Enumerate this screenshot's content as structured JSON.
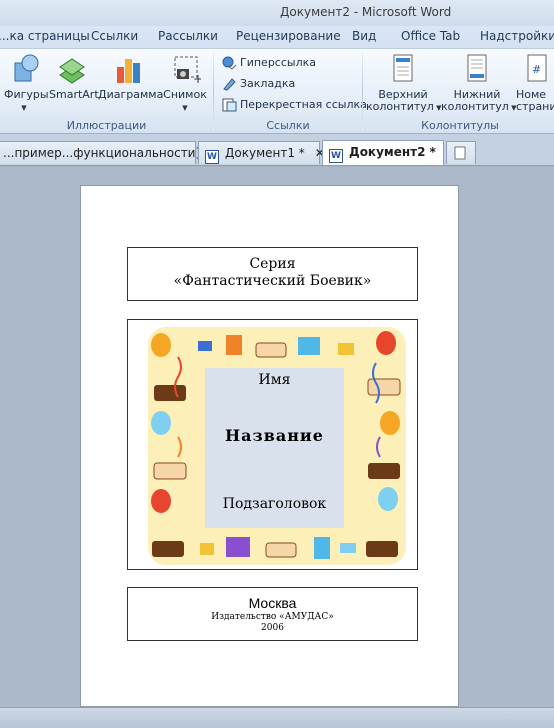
{
  "window": {
    "title": "Документ2  -  Microsoft Word"
  },
  "ribbon_tabs": [
    "...ка страницы",
    "Ссылки",
    "Рассылки",
    "Рецензирование",
    "Вид",
    "Office Tab",
    "Надстройки"
  ],
  "ribbon": {
    "illustrations": {
      "label": "Иллюстрации",
      "buttons": [
        "Фигуры",
        "SmartArt",
        "Диаграмма",
        "Снимок"
      ]
    },
    "links": {
      "label": "Ссылки",
      "buttons": [
        "Гиперссылка",
        "Закладка",
        "Перекрестная ссылка"
      ]
    },
    "headers": {
      "label": "Колонтитулы",
      "header_line1": "Верхний",
      "header_line2": "колонтитул",
      "footer_line1": "Нижний",
      "footer_line2": "колонтитул",
      "pagenum_line1": "Номе",
      "pagenum_line2": "страни"
    }
  },
  "doc_tabs": {
    "tab1": "...пример...функциональности] *",
    "tab2": "Документ1 *",
    "tab3": "Документ2 *",
    "close": "✕"
  },
  "document": {
    "series_line1": "Серия",
    "series_line2": "«Фантастический Боевик»",
    "name": "Имя",
    "title": "Название",
    "subtitle": "Подзаголовок",
    "city": "Москва",
    "publisher": "Издательство «АМУДАС»",
    "year": "2006"
  },
  "colors": {
    "ribbon_bg": "#e3ecf7",
    "frame_bg": "#fcefb8",
    "inner_bg": "#d9e1ec",
    "workspace_bg": "#abb9cb"
  },
  "icons": [
    "shapes-icon",
    "smartart-icon",
    "chart-icon",
    "screenshot-icon",
    "hyperlink-icon",
    "bookmark-icon",
    "cross-reference-icon",
    "header-icon",
    "footer-icon",
    "page-number-icon",
    "word-doc-icon",
    "new-tab-icon"
  ]
}
